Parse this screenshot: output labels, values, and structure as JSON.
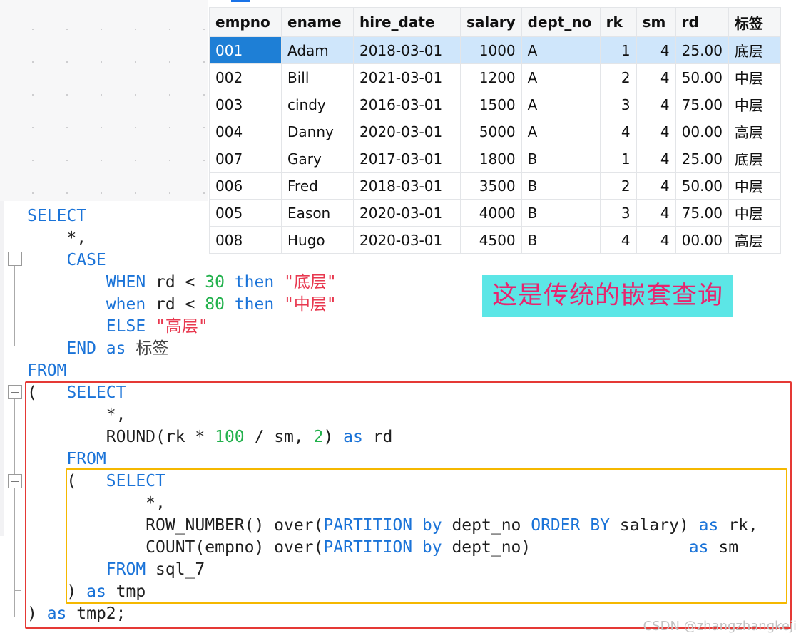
{
  "table": {
    "columns": [
      "empno",
      "ename",
      "hire_date",
      "salary",
      "dept_no",
      "rk",
      "sm",
      "rd",
      "标签"
    ],
    "rows": [
      [
        "001",
        "Adam",
        "2018-03-01",
        "1000",
        "A",
        "1",
        "4",
        "25.00",
        "底层"
      ],
      [
        "002",
        "Bill",
        "2021-03-01",
        "1200",
        "A",
        "2",
        "4",
        "50.00",
        "中层"
      ],
      [
        "003",
        "cindy",
        "2016-03-01",
        "1500",
        "A",
        "3",
        "4",
        "75.00",
        "中层"
      ],
      [
        "004",
        "Danny",
        "2020-03-01",
        "5000",
        "A",
        "4",
        "4",
        "00.00",
        "高层"
      ],
      [
        "007",
        "Gary",
        "2017-03-01",
        "1800",
        "B",
        "1",
        "4",
        "25.00",
        "底层"
      ],
      [
        "006",
        "Fred",
        "2018-03-01",
        "3500",
        "B",
        "2",
        "4",
        "50.00",
        "中层"
      ],
      [
        "005",
        "Eason",
        "2020-03-01",
        "4000",
        "B",
        "3",
        "4",
        "75.00",
        "中层"
      ],
      [
        "008",
        "Hugo",
        "2020-03-01",
        "4500",
        "B",
        "4",
        "4",
        "00.00",
        "高层"
      ]
    ],
    "selected_row": 0
  },
  "code": [
    [
      [
        "kw",
        "SELECT"
      ]
    ],
    [
      [
        "plain",
        "    *,"
      ]
    ],
    [
      [
        "plain",
        "    "
      ],
      [
        "kw",
        "CASE"
      ]
    ],
    [
      [
        "plain",
        "        "
      ],
      [
        "kw",
        "WHEN"
      ],
      [
        "plain",
        " rd < "
      ],
      [
        "num-lit",
        "30"
      ],
      [
        "plain",
        " "
      ],
      [
        "kw",
        "then"
      ],
      [
        "plain",
        " "
      ],
      [
        "str-lit",
        "\"底层\""
      ]
    ],
    [
      [
        "plain",
        "        "
      ],
      [
        "kw",
        "when"
      ],
      [
        "plain",
        " rd < "
      ],
      [
        "num-lit",
        "80"
      ],
      [
        "plain",
        " "
      ],
      [
        "kw",
        "then"
      ],
      [
        "plain",
        " "
      ],
      [
        "str-lit",
        "\"中层\""
      ]
    ],
    [
      [
        "plain",
        "        "
      ],
      [
        "kw",
        "ELSE"
      ],
      [
        "plain",
        " "
      ],
      [
        "str-lit",
        "\"高层\""
      ]
    ],
    [
      [
        "plain",
        "    "
      ],
      [
        "kw",
        "END"
      ],
      [
        "plain",
        " "
      ],
      [
        "kw",
        "as"
      ],
      [
        "plain",
        " "
      ],
      [
        "cn-plain",
        "标签"
      ]
    ],
    [
      [
        "kw",
        "FROM"
      ]
    ],
    [
      [
        "plain",
        "(   "
      ],
      [
        "kw",
        "SELECT"
      ]
    ],
    [
      [
        "plain",
        "        *,"
      ]
    ],
    [
      [
        "plain",
        "        ROUND(rk * "
      ],
      [
        "num-lit",
        "100"
      ],
      [
        "plain",
        " / sm, "
      ],
      [
        "num-lit",
        "2"
      ],
      [
        "plain",
        ") "
      ],
      [
        "kw",
        "as"
      ],
      [
        "plain",
        " rd"
      ]
    ],
    [
      [
        "plain",
        "    "
      ],
      [
        "kw",
        "FROM"
      ]
    ],
    [
      [
        "plain",
        "    (   "
      ],
      [
        "kw",
        "SELECT"
      ]
    ],
    [
      [
        "plain",
        "            *,"
      ]
    ],
    [
      [
        "plain",
        "            ROW_NUMBER() over("
      ],
      [
        "kw",
        "PARTITION"
      ],
      [
        "plain",
        " "
      ],
      [
        "kw",
        "by"
      ],
      [
        "plain",
        " dept_no "
      ],
      [
        "kw",
        "ORDER BY"
      ],
      [
        "plain",
        " salary) "
      ],
      [
        "kw",
        "as"
      ],
      [
        "plain",
        " rk,"
      ]
    ],
    [
      [
        "plain",
        "            COUNT(empno) over("
      ],
      [
        "kw",
        "PARTITION"
      ],
      [
        "plain",
        " "
      ],
      [
        "kw",
        "by"
      ],
      [
        "plain",
        " dept_no)                "
      ],
      [
        "kw",
        "as"
      ],
      [
        "plain",
        " sm"
      ]
    ],
    [
      [
        "plain",
        "        "
      ],
      [
        "kw",
        "FROM"
      ],
      [
        "plain",
        " sql_7"
      ]
    ],
    [
      [
        "plain",
        "    ) "
      ],
      [
        "kw",
        "as"
      ],
      [
        "plain",
        " tmp"
      ]
    ],
    [
      [
        "plain",
        ") "
      ],
      [
        "kw",
        "as"
      ],
      [
        "plain",
        " tmp2;"
      ]
    ]
  ],
  "annotation": "这是传统的嵌套查询",
  "watermark": "CSDN @zhangzhangkeji",
  "colors": {
    "keyword": "#1a73d8",
    "number": "#22b14c",
    "string": "#e8384f",
    "outer_box": "#e53935",
    "inner_box": "#f5b800",
    "callout_bg": "#5ce6e6",
    "callout_text": "#e8246e",
    "selected_row": "#cfe6fb",
    "focused_cell": "#1e7fd6"
  }
}
